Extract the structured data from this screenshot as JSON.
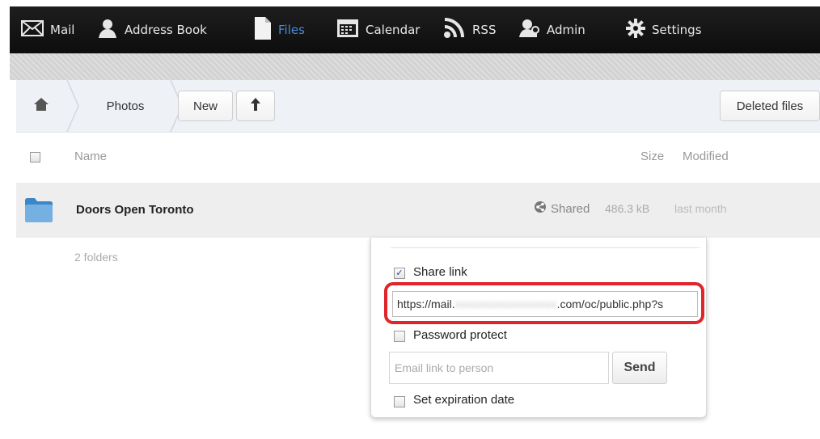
{
  "nav": {
    "items": [
      {
        "label": "Mail",
        "icon": "mail-icon"
      },
      {
        "label": "Address Book",
        "icon": "person-icon"
      },
      {
        "label": "Files",
        "icon": "file-icon",
        "active": true
      },
      {
        "label": "Calendar",
        "icon": "calendar-icon"
      },
      {
        "label": "RSS",
        "icon": "rss-icon"
      },
      {
        "label": "Admin",
        "icon": "admin-icon"
      },
      {
        "label": "Settings",
        "icon": "gear-icon"
      }
    ]
  },
  "controls": {
    "breadcrumb": [
      "Photos"
    ],
    "new_label": "New",
    "deleted_label": "Deleted files"
  },
  "list": {
    "header": {
      "name": "Name",
      "size": "Size",
      "modified": "Modified"
    },
    "rows": [
      {
        "name": "Doors Open Toronto",
        "shared": "Shared",
        "size": "486.3 kB",
        "modified": "last month"
      }
    ],
    "summary": "2 folders"
  },
  "share": {
    "share_link_label": "Share link",
    "share_link_checked": true,
    "link_prefix": "https://mail.",
    "link_suffix": ".com/oc/public.php?s",
    "password_label": "Password protect",
    "email_placeholder": "Email link to person",
    "send_label": "Send",
    "expiration_label": "Set expiration date"
  },
  "colors": {
    "active_nav": "#4a8ad6",
    "highlight": "#e0242a",
    "topbar": "#141414"
  }
}
